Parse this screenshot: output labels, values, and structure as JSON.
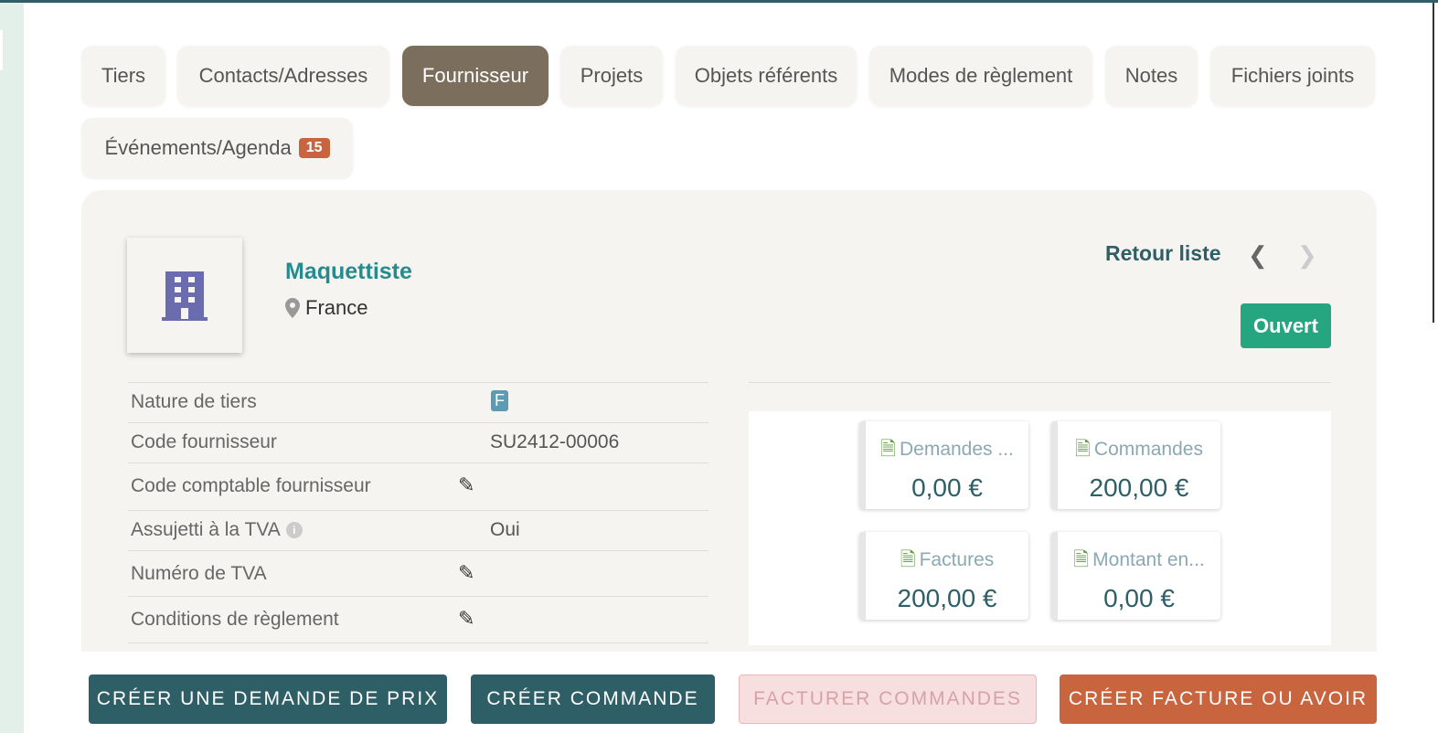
{
  "tabs": [
    {
      "label": "Tiers"
    },
    {
      "label": "Contacts/Adresses"
    },
    {
      "label": "Fournisseur"
    },
    {
      "label": "Projets"
    },
    {
      "label": "Objets référents"
    },
    {
      "label": "Modes de règlement"
    },
    {
      "label": "Notes"
    },
    {
      "label": "Fichiers joints"
    },
    {
      "label": "Événements/Agenda",
      "badge": "15"
    }
  ],
  "active_tab": "Fournisseur",
  "company": {
    "name": "Maquettiste",
    "country": "France",
    "status": "Ouvert",
    "retour_label": "Retour liste",
    "logo_icon": "building-icon",
    "logo_color": "#6b6bb0"
  },
  "fields": [
    {
      "label": "Nature de tiers",
      "value": "F"
    },
    {
      "label": "Code fournisseur",
      "value": "SU2412-00006"
    },
    {
      "label": "Code comptable fournisseur",
      "value": ""
    },
    {
      "label": "Assujetti à la TVA",
      "value": "Oui"
    },
    {
      "label": "Numéro de TVA",
      "value": ""
    },
    {
      "label": "Conditions de règlement",
      "value": ""
    }
  ],
  "stats": [
    {
      "label": "Demandes ...",
      "value": "0,00 €"
    },
    {
      "label": "Commandes",
      "value": "200,00 €"
    },
    {
      "label": "Factures",
      "value": "200,00 €"
    },
    {
      "label": "Montant en...",
      "value": "0,00 €"
    }
  ],
  "actions": {
    "demande_prix": "CRÉER UNE DEMANDE DE PRIX",
    "creer_commande": "CRÉER COMMANDE",
    "facturer_commandes": "FACTURER COMMANDES",
    "creer_facture": "CRÉER FACTURE OU AVOIR"
  },
  "colors": {
    "accent": "#2f5f66",
    "active_tab": "#7b6e5c",
    "status_open": "#25a580",
    "badge": "#c8653f"
  }
}
